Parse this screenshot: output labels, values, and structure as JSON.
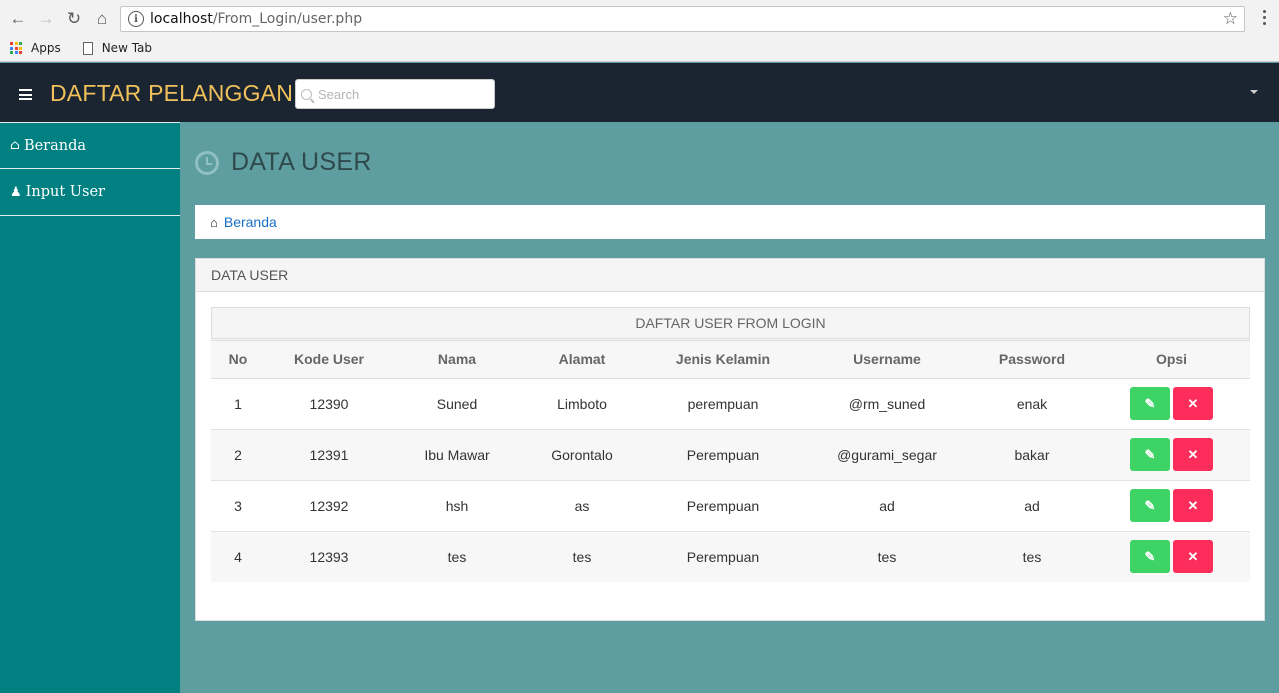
{
  "browser": {
    "url_host": "localhost",
    "url_path": "/From_Login/user.php",
    "bookmarks": [
      "Apps",
      "New Tab"
    ]
  },
  "navbar": {
    "brand": "DAFTAR PELANGGAN",
    "search_placeholder": "Search"
  },
  "sidebar": {
    "items": [
      {
        "label": "Beranda",
        "icon": "home-icon"
      },
      {
        "label": "Input User",
        "icon": "user-icon"
      }
    ]
  },
  "page": {
    "title": "DATA USER",
    "breadcrumb": "Beranda"
  },
  "panel": {
    "title": "DATA USER",
    "table_caption": "DAFTAR USER FROM LOGIN",
    "columns": [
      "No",
      "Kode User",
      "Nama",
      "Alamat",
      "Jenis Kelamin",
      "Username",
      "Password",
      "Opsi"
    ],
    "rows": [
      [
        "1",
        "12390",
        "Suned",
        "Limboto",
        "perempuan",
        "@rm_suned",
        "enak"
      ],
      [
        "2",
        "12391",
        "Ibu Mawar",
        "Gorontalo",
        "Perempuan",
        "@gurami_segar",
        "bakar"
      ],
      [
        "3",
        "12392",
        "hsh",
        "as",
        "Perempuan",
        "ad",
        "ad"
      ],
      [
        "4",
        "12393",
        "tes",
        "tes",
        "Perempuan",
        "tes",
        "tes"
      ]
    ]
  },
  "colors": {
    "navbar_bg": "#1b2531",
    "brand": "#f0c15b",
    "sidebar_bg": "#008080",
    "content_bg": "#5f9ea0",
    "edit_button": "#3dd365",
    "delete_button": "#fc2d5a"
  }
}
